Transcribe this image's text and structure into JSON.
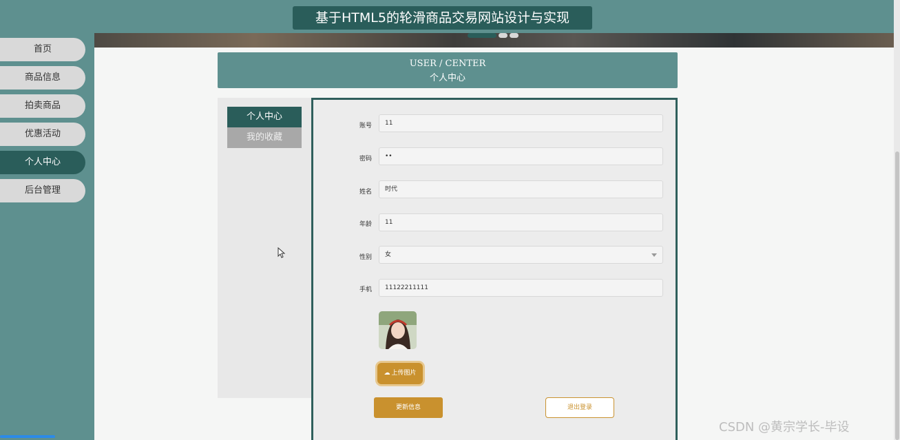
{
  "site": {
    "title": "基于HTML5的轮滑商品交易网站设计与实现"
  },
  "sidebar": {
    "items": [
      {
        "label": "首页",
        "active": false
      },
      {
        "label": "商品信息",
        "active": false
      },
      {
        "label": "拍卖商品",
        "active": false
      },
      {
        "label": "优惠活动",
        "active": false
      },
      {
        "label": "个人中心",
        "active": true
      },
      {
        "label": "后台管理",
        "active": false
      }
    ]
  },
  "user_center": {
    "title_en": "USER / CENTER",
    "title_cn": "个人中心",
    "tabs": [
      {
        "label": "个人中心",
        "active": true
      },
      {
        "label": "我的收藏",
        "active": false
      }
    ]
  },
  "form": {
    "account": {
      "label": "账号",
      "value": "11"
    },
    "password": {
      "label": "密码",
      "value": "••"
    },
    "name": {
      "label": "姓名",
      "value": "时代"
    },
    "age": {
      "label": "年龄",
      "value": "11"
    },
    "gender": {
      "label": "性别",
      "value": "女"
    },
    "phone": {
      "label": "手机",
      "value": "11122211111"
    },
    "upload_label": "上传图片",
    "update_label": "更新信息",
    "logout_label": "退出登录"
  },
  "watermark": "CSDN @黄宗学长-毕设",
  "colors": {
    "primary": "#5e908f",
    "dark": "#2a5d5a",
    "accent": "#c9912e"
  }
}
